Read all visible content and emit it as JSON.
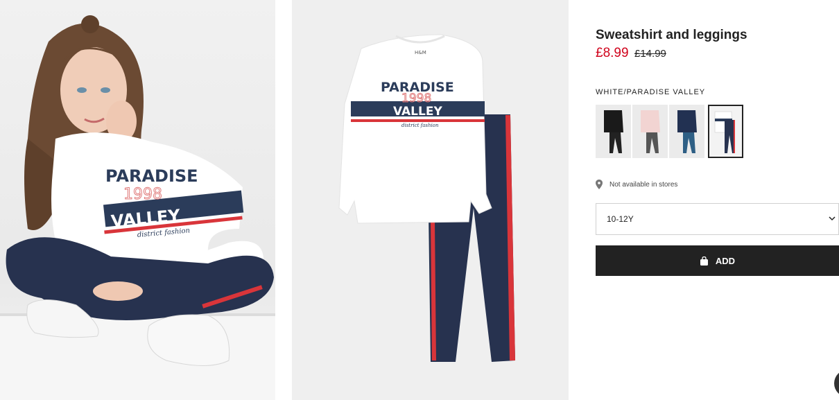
{
  "product": {
    "title": "Sweatshirt and leggings",
    "price_now": "£8.99",
    "price_was": "£14.99",
    "color_label": "WHITE/PARADISE VALLEY",
    "store_availability": "Not available in stores",
    "size_selected": "10-12Y",
    "add_label": "ADD"
  },
  "print_text": {
    "line1": "PARADISE",
    "line2": "1998",
    "line3": "VALLEY",
    "line4": "district fashion",
    "tag": "H&M"
  },
  "colors": {
    "price_red": "#d0021b",
    "button_black": "#222222",
    "navy": "#2b3c5a",
    "stripe_red": "#d9353a"
  },
  "swatches": [
    {
      "name": "black",
      "selected": false
    },
    {
      "name": "light pink",
      "selected": false
    },
    {
      "name": "dark blue",
      "selected": false
    },
    {
      "name": "white/paradise valley",
      "selected": true
    }
  ]
}
